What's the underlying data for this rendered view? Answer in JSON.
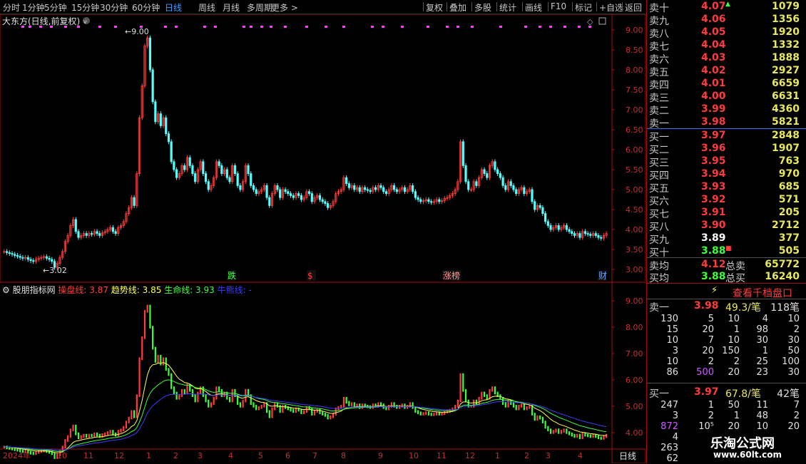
{
  "toolbar": {
    "left": [
      "分时",
      "1分钟",
      "5分钟",
      "15分钟",
      "30分钟",
      "60分钟",
      "日线",
      "周线",
      "月线",
      "多周期",
      "更多 >"
    ],
    "right": [
      "复权",
      "叠加",
      "多股",
      "统计",
      "画线",
      "F10",
      "标记",
      "+自选",
      "返回"
    ]
  },
  "chart": {
    "title": "大东方(日线,前复权)",
    "high_label": "9.00",
    "low_label": "3.02",
    "y_ticks": [
      "9.00",
      "8.50",
      "8.00",
      "7.50",
      "7.00",
      "6.50",
      "6.00",
      "5.50",
      "5.00",
      "4.50",
      "4.00",
      "3.50",
      "3.00"
    ],
    "events": [
      {
        "text": "跌",
        "x": 1,
        "color": "#3cff3c"
      },
      {
        "text": "$",
        "x": 2,
        "color": "#ff3c3c"
      },
      {
        "text": "涨榜",
        "x": 3,
        "color": "#ff9b9b"
      },
      {
        "text": "财",
        "x": 4,
        "color": "#6aa0ff"
      }
    ],
    "candles": [
      3.45,
      3.42,
      3.4,
      3.38,
      3.35,
      3.33,
      3.3,
      3.28,
      3.3,
      3.25,
      3.22,
      3.2,
      3.25,
      3.28,
      3.3,
      3.32,
      3.28,
      3.25,
      3.2,
      3.05,
      3.15,
      3.3,
      3.45,
      3.7,
      3.85,
      4.1,
      4.25,
      3.95,
      3.8,
      3.85,
      3.9,
      3.85,
      3.9,
      3.88,
      3.95,
      3.9,
      3.85,
      3.92,
      3.95,
      4.0,
      4.05,
      3.95,
      3.9,
      4.05,
      4.1,
      4.2,
      4.4,
      4.55,
      4.8,
      4.6,
      5.4,
      6.8,
      7.6,
      8.6,
      8.8,
      8.0,
      7.2,
      6.7,
      6.9,
      6.6,
      6.8,
      6.4,
      6.2,
      5.7,
      5.5,
      5.3,
      5.4,
      5.6,
      5.5,
      5.8,
      5.6,
      5.4,
      5.2,
      5.5,
      5.7,
      5.4,
      5.2,
      5.0,
      5.1,
      5.3,
      5.7,
      5.6,
      5.4,
      5.5,
      5.3,
      5.2,
      5.6,
      5.4,
      5.1,
      5.0,
      5.2,
      5.6,
      5.4,
      5.1,
      5.0,
      4.9,
      4.95,
      5.0,
      5.1,
      4.8,
      4.6,
      4.9,
      5.1,
      5.0,
      4.8,
      5.0,
      4.95,
      4.9,
      4.85,
      4.8,
      4.9,
      4.85,
      4.75,
      4.8,
      4.95,
      4.9,
      4.7,
      4.8,
      4.85,
      4.75,
      4.7,
      4.65,
      4.55,
      4.6,
      4.7,
      4.9,
      4.95,
      5.0,
      5.3,
      5.15,
      5.05,
      5.1,
      5.0,
      5.05,
      4.95,
      5.05,
      5.0,
      4.98,
      4.95,
      5.05,
      5.0,
      5.1,
      5.05,
      4.95,
      4.9,
      5.0,
      5.1,
      5.0,
      4.95,
      5.0,
      5.05,
      4.95,
      5.0,
      5.1,
      4.95,
      4.8,
      4.75,
      4.7,
      4.72,
      4.75,
      4.7,
      4.68,
      4.7,
      4.75,
      4.7,
      4.72,
      4.78,
      4.8,
      4.85,
      4.9,
      5.0,
      5.2,
      6.2,
      5.6,
      5.2,
      5.0,
      5.0,
      5.2,
      5.1,
      5.3,
      5.5,
      5.4,
      5.3,
      5.6,
      5.7,
      5.5,
      5.4,
      5.3,
      5.1,
      5.0,
      5.2,
      5.1,
      5.0,
      4.9,
      5.0,
      5.05,
      4.9,
      4.95,
      5.0,
      4.7,
      4.5,
      4.6,
      4.55,
      4.4,
      4.2,
      4.1,
      4.0,
      4.05,
      4.1,
      4.0,
      4.05,
      4.1,
      4.0,
      3.95,
      3.9,
      3.85,
      3.9,
      3.8,
      3.95,
      3.9,
      3.88,
      3.85,
      3.9,
      3.85,
      3.8,
      3.78,
      3.85,
      3.9
    ]
  },
  "indicator": {
    "name": "股朋指标网",
    "lines": [
      {
        "label": "操盘线:",
        "value": "3.87",
        "color": "#ff3c3c"
      },
      {
        "label": "趋势线:",
        "value": "3.85",
        "color": "#ffff54"
      },
      {
        "label": "生命线:",
        "value": "3.93",
        "color": "#3cff3c"
      },
      {
        "label": "牛熊线:",
        "value": "-",
        "color": "#3c3cff"
      }
    ],
    "y_ticks": [
      "9.00",
      "8.00",
      "7.00",
      "6.00",
      "5.00",
      "4.00"
    ]
  },
  "x_axis": {
    "labels": [
      "2024年",
      "10",
      "11",
      "12",
      "1",
      "2",
      "3",
      "4",
      "5",
      "6",
      "7",
      "8",
      "9",
      "10",
      "11",
      "12",
      "1",
      "2",
      "3",
      "4"
    ],
    "period": "日线"
  },
  "orderbook": {
    "asks": [
      {
        "label": "卖十",
        "price": "4.07",
        "vol": "1079",
        "mark": "▲"
      },
      {
        "label": "卖九",
        "price": "4.06",
        "vol": "1356"
      },
      {
        "label": "卖八",
        "price": "4.05",
        "vol": "1920"
      },
      {
        "label": "卖七",
        "price": "4.04",
        "vol": "1332"
      },
      {
        "label": "卖六",
        "price": "4.03",
        "vol": "1888"
      },
      {
        "label": "卖五",
        "price": "4.02",
        "vol": "2927"
      },
      {
        "label": "卖四",
        "price": "4.01",
        "vol": "6659"
      },
      {
        "label": "卖三",
        "price": "4.00",
        "vol": "6631"
      },
      {
        "label": "卖二",
        "price": "3.99",
        "vol": "4360"
      },
      {
        "label": "卖一",
        "price": "3.98",
        "vol": "5821"
      }
    ],
    "bids": [
      {
        "label": "买一",
        "price": "3.97",
        "vol": "2848",
        "color": "#ff3c3c"
      },
      {
        "label": "买二",
        "price": "3.96",
        "vol": "1907",
        "color": "#ff3c3c"
      },
      {
        "label": "买三",
        "price": "3.95",
        "vol": "763",
        "color": "#ff3c3c"
      },
      {
        "label": "买四",
        "price": "3.94",
        "vol": "970",
        "color": "#ff3c3c"
      },
      {
        "label": "买五",
        "price": "3.93",
        "vol": "685",
        "color": "#ff3c3c"
      },
      {
        "label": "买六",
        "price": "3.92",
        "vol": "571",
        "color": "#ff3c3c"
      },
      {
        "label": "买七",
        "price": "3.91",
        "vol": "205",
        "color": "#ff3c3c"
      },
      {
        "label": "买八",
        "price": "3.90",
        "vol": "2712",
        "color": "#ff3c3c"
      },
      {
        "label": "买九",
        "price": "3.89",
        "vol": "377",
        "color": "#ffffff"
      },
      {
        "label": "买十",
        "price": "3.88",
        "vol": "505",
        "color": "#3cff3c",
        "mark": "■"
      }
    ],
    "avg_sell": {
      "label": "卖均",
      "price": "4.12",
      "total_label": "总卖",
      "total": "65772"
    },
    "avg_buy": {
      "label": "买均",
      "price": "3.88",
      "total_label": "总买",
      "total": "16240"
    },
    "thousand_btn": "查看千档盘口",
    "sell1": {
      "label": "卖一",
      "price": "3.98",
      "per": "49.3/笔",
      "count": "118笔"
    },
    "sell_grid": [
      [
        "130",
        "5",
        "10",
        "4",
        "10"
      ],
      [
        "15",
        "20",
        "1",
        "98",
        "2"
      ],
      [
        "10",
        "7",
        "10",
        "30",
        "30"
      ],
      [
        "3",
        "20",
        "150",
        "1",
        "50"
      ],
      [
        "10",
        "2",
        "2",
        "25",
        "100"
      ],
      [
        "86",
        "500",
        "20",
        "23",
        "30"
      ]
    ],
    "buy1": {
      "label": "买一",
      "price": "3.97",
      "per": "67.8/笔",
      "count": "42笔"
    },
    "buy_grid": [
      [
        "247",
        "1",
        "50",
        "11",
        "7"
      ],
      [
        "3",
        "2",
        "1",
        "48",
        "2"
      ],
      [
        "872",
        "10⁵",
        "20",
        "10",
        "20"
      ],
      [
        "4",
        "",
        "",
        "",
        ""
      ],
      [
        "263",
        "",
        "",
        "",
        ""
      ],
      [
        "62",
        "",
        "",
        "",
        ""
      ]
    ]
  },
  "watermark": {
    "title": "乐淘公式网",
    "url": "www.60lt.com"
  }
}
